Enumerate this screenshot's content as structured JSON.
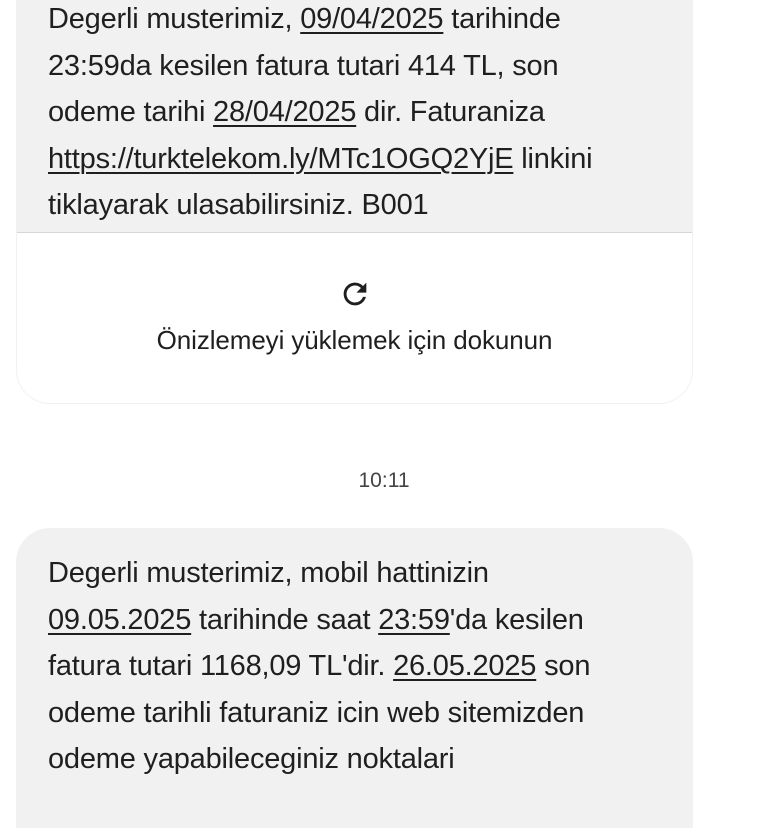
{
  "messages": [
    {
      "lines": [
        [
          {
            "t": "Degerli musterimiz, "
          },
          {
            "t": "09/04/2025",
            "u": true
          },
          {
            "t": " tarihinde"
          }
        ],
        [
          {
            "t": "23:59da kesilen fatura tutari 414 TL, son"
          }
        ],
        [
          {
            "t": "odeme tarihi "
          },
          {
            "t": "28/04/2025",
            "u": true
          },
          {
            "t": " dir. Faturaniza"
          }
        ],
        [
          {
            "t": "https://turktelekom.ly/MTc1OGQ2YjE",
            "u": true
          },
          {
            "t": " linkini"
          }
        ],
        [
          {
            "t": "tiklayarak ulasabilirsiniz. B001"
          }
        ]
      ],
      "preview": {
        "icon": "reload-icon",
        "label": "Önizlemeyi yüklemek için dokunun"
      }
    },
    {
      "lines": [
        [
          {
            "t": "Degerli musterimiz, mobil hattinizin"
          }
        ],
        [
          {
            "t": "09.05.2025",
            "u": true
          },
          {
            "t": " tarihinde saat "
          },
          {
            "t": "23:59",
            "u": true
          },
          {
            "t": "'da kesilen"
          }
        ],
        [
          {
            "t": "fatura tutari 1168,09 TL'dir. "
          },
          {
            "t": "26.05.2025",
            "u": true
          },
          {
            "t": " son"
          }
        ],
        [
          {
            "t": "odeme tarihli faturaniz icin web sitemizden"
          }
        ],
        [
          {
            "t": "odeme yapabileceginiz noktalari"
          }
        ]
      ]
    }
  ],
  "timestamp": "10:11",
  "colors": {
    "bubble_bg": "#f1f1f1",
    "text": "#1f1f1f",
    "timestamp_text": "#444444",
    "preview_bg": "#ffffff",
    "preview_border": "#d6d6d6"
  }
}
